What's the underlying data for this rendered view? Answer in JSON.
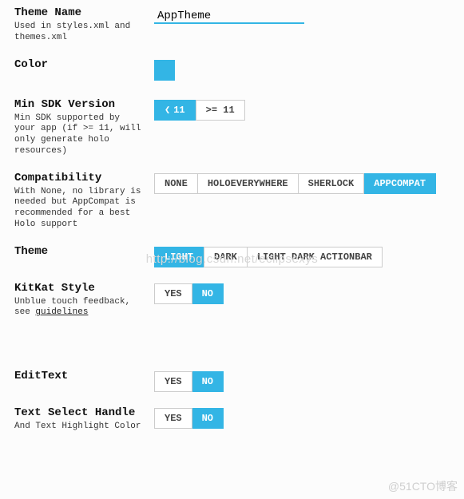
{
  "accent": "#33b5e5",
  "themeName": {
    "label": "Theme Name",
    "hint": "Used in styles.xml and themes.xml",
    "value": "AppTheme"
  },
  "color": {
    "label": "Color",
    "swatch": "#33b5e5"
  },
  "minSdk": {
    "label": "Min SDK Version",
    "hint": "Min SDK supported by your app (if >= 11, will only generate holo resources)",
    "options": [
      "< 11",
      ">= 11"
    ],
    "selected": 0
  },
  "compat": {
    "label": "Compatibility",
    "hint": "With None, no library is needed but AppCompat is recommended for a best Holo support",
    "options": [
      "NONE",
      "HOLOEVERYWHERE",
      "SHERLOCK",
      "APPCOMPAT"
    ],
    "selected": 3
  },
  "theme": {
    "label": "Theme",
    "options": [
      "LIGHT",
      "DARK",
      "LIGHT DARK ACTIONBAR"
    ],
    "selected": 0
  },
  "kitkat": {
    "label": "KitKat Style",
    "hint_prefix": "Unblue touch feedback, see ",
    "hint_link": "guidelines",
    "options": [
      "YES",
      "NO"
    ],
    "selected": 1
  },
  "edittext": {
    "label": "EditText",
    "options": [
      "YES",
      "NO"
    ],
    "selected": 1
  },
  "textSelect": {
    "label": "Text Select Handle",
    "hint": "And Text Highlight Color",
    "options": [
      "YES",
      "NO"
    ],
    "selected": 1
  },
  "watermarks": {
    "center": "http://blog.csdn.net/eclipsexys",
    "br": "@51CTO博客"
  }
}
